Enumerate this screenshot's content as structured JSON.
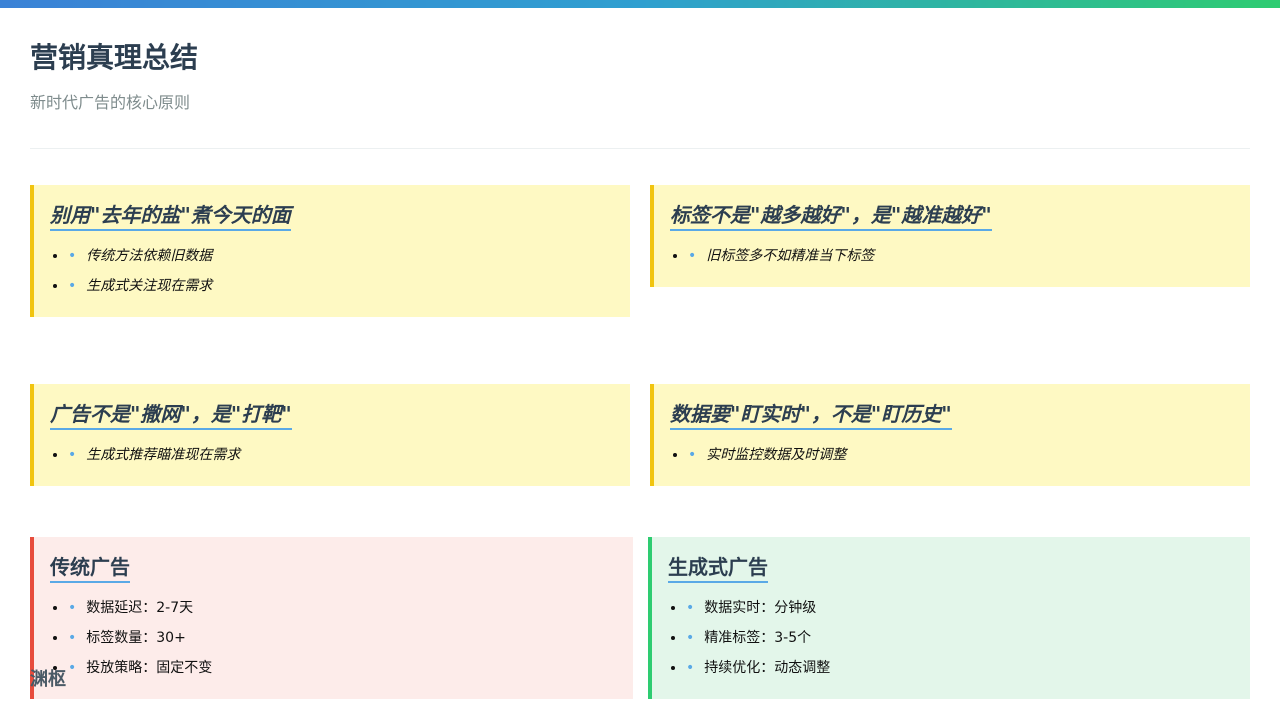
{
  "header": {
    "title": "营销真理总结",
    "subtitle": "新时代广告的核心原则"
  },
  "cards": [
    {
      "title": "别用\"去年的盐\"煮今天的面",
      "items": [
        "传统方法依赖旧数据",
        "生成式关注现在需求"
      ]
    },
    {
      "title": "标签不是\"越多越好\"，是\"越准越好\"",
      "items": [
        "旧标签多不如精准当下标签"
      ]
    },
    {
      "title": "广告不是\"撒网\"，是\"打靶\"",
      "items": [
        "生成式推荐瞄准现在需求"
      ]
    },
    {
      "title": "数据要\"盯实时\"，不是\"盯历史\"",
      "items": [
        "实时监控数据及时调整"
      ]
    }
  ],
  "comparison": {
    "traditional": {
      "title": "传统广告",
      "items": [
        "数据延迟：2-7天",
        "标签数量：30+",
        "投放策略：固定不变"
      ]
    },
    "generative": {
      "title": "生成式广告",
      "items": [
        "数据实时：分钟级",
        "精准标签：3-5个",
        "持续优化：动态调整"
      ]
    }
  },
  "bullet_glyph": "•",
  "watermark": "渊枢",
  "colors": {
    "accent_yellow": "#f1c40f",
    "accent_red": "#e74c3c",
    "accent_green": "#2ecc71",
    "underline_blue": "#5aa9e6"
  }
}
